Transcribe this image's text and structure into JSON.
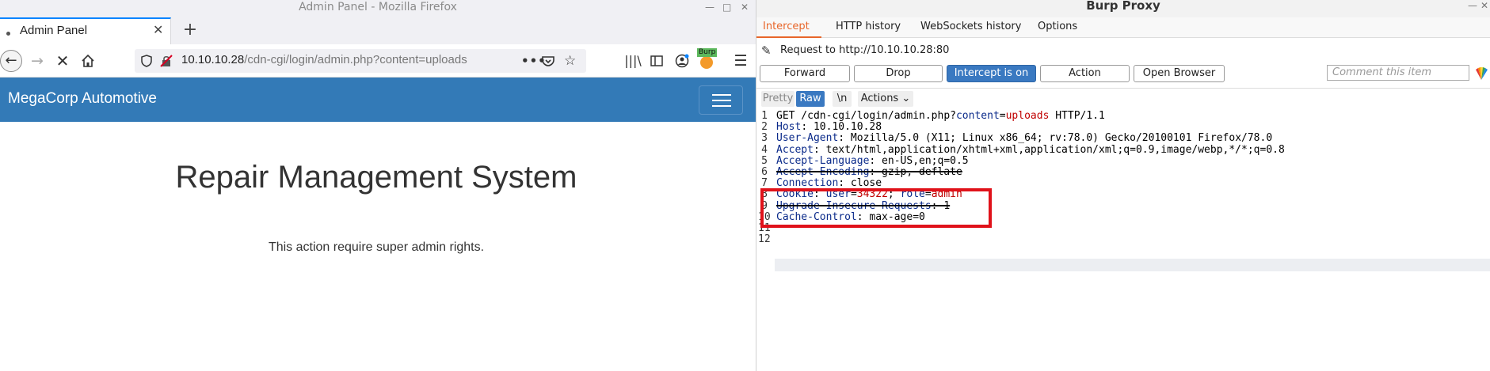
{
  "firefox": {
    "window_title": "Admin Panel - Mozilla Firefox",
    "window_controls": [
      "—",
      "□",
      "✕"
    ],
    "tab": {
      "label": "Admin Panel",
      "close": "✕"
    },
    "new_tab": "+",
    "url": {
      "host": "10.10.10.28",
      "path": "/cdn-cgi/login/admin.php?content=uploads"
    },
    "toolbar_icons": [
      "library-icon",
      "sidebar-icon",
      "account-icon",
      "burp-extension-icon",
      "menu-icon"
    ],
    "burp_badge": "Burp",
    "page": {
      "brand": "MegaCorp Automotive",
      "heading": "Repair Management System",
      "message": "This action require super admin rights."
    }
  },
  "burp": {
    "window_title": "Burp Proxy",
    "window_controls": [
      "—",
      "✕"
    ],
    "tabs": [
      "Intercept",
      "HTTP history",
      "WebSockets history",
      "Options"
    ],
    "active_tab": "Intercept",
    "request_to": "Request to http://10.10.10.28:80",
    "buttons": {
      "forward": "Forward",
      "drop": "Drop",
      "intercept": "Intercept is on",
      "action": "Action",
      "open_browser": "Open Browser"
    },
    "comment_placeholder": "Comment this item",
    "editor_tabs": {
      "pretty": "Pretty",
      "raw": "Raw",
      "newline": "\\n",
      "actions": "Actions"
    },
    "request_lines": [
      {
        "num": "1",
        "parts": [
          [
            "t",
            "GET /cdn-cgi/login/admin.php?"
          ],
          [
            "pk",
            "content"
          ],
          [
            "t",
            "="
          ],
          [
            "pv",
            "uploads"
          ],
          [
            "t",
            " HTTP/1.1"
          ]
        ]
      },
      {
        "num": "2",
        "parts": [
          [
            "hk",
            "Host"
          ],
          [
            "t",
            ": 10.10.10.28"
          ]
        ]
      },
      {
        "num": "3",
        "parts": [
          [
            "hk",
            "User-Agent"
          ],
          [
            "t",
            ": Mozilla/5.0 (X11; Linux x86_64; rv:78.0) Gecko/20100101 Firefox/78.0"
          ]
        ]
      },
      {
        "num": "4",
        "parts": [
          [
            "hk",
            "Accept"
          ],
          [
            "t",
            ": text/html,application/xhtml+xml,application/xml;q=0.9,image/webp,*/*;q=0.8"
          ]
        ]
      },
      {
        "num": "5",
        "parts": [
          [
            "hk",
            "Accept-Language"
          ],
          [
            "t",
            ": en-US,en;q=0.5"
          ]
        ]
      },
      {
        "num": "6",
        "strike": true,
        "parts": [
          [
            "hk",
            "Accept-Encoding"
          ],
          [
            "t",
            ": gzip, deflate"
          ]
        ]
      },
      {
        "num": "7",
        "parts": [
          [
            "hk",
            "Connection"
          ],
          [
            "t",
            ": close"
          ]
        ]
      },
      {
        "num": "8",
        "parts": [
          [
            "hk",
            "Cookie"
          ],
          [
            "t",
            ": "
          ],
          [
            "pk",
            "user"
          ],
          [
            "t",
            "="
          ],
          [
            "pv",
            "34322"
          ],
          [
            "t",
            "; "
          ],
          [
            "pk",
            "role"
          ],
          [
            "t",
            "="
          ],
          [
            "pv",
            "admin"
          ]
        ]
      },
      {
        "num": "9",
        "strike": true,
        "parts": [
          [
            "hk",
            "Upgrade-Insecure-Requests"
          ],
          [
            "t",
            ": 1"
          ]
        ]
      },
      {
        "num": "10",
        "parts": [
          [
            "hk",
            "Cache-Control"
          ],
          [
            "t",
            ": max-age=0"
          ]
        ]
      },
      {
        "num": "11",
        "parts": []
      },
      {
        "num": "12",
        "parts": []
      }
    ]
  }
}
